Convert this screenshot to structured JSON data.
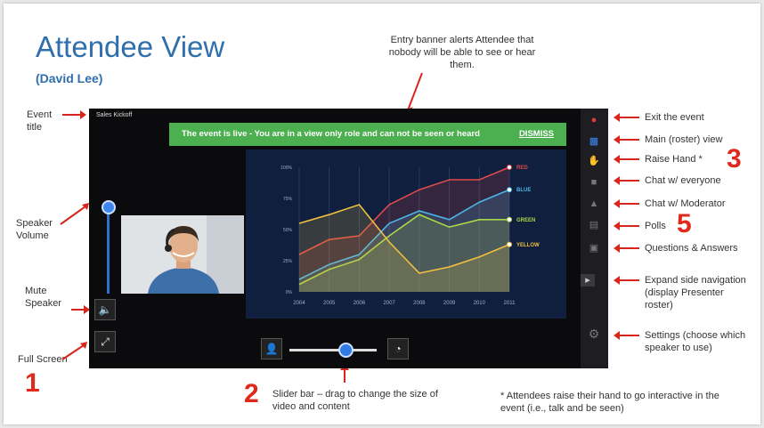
{
  "header": {
    "title": "Attendee View",
    "subtitle": "(David Lee)"
  },
  "annotations": {
    "entry_banner": "Entry banner alerts Attendee that nobody will be able to see or hear them.",
    "event_title": "Event title",
    "speaker_volume": "Speaker Volume",
    "mute_speaker": "Mute Speaker",
    "full_screen": "Full Screen",
    "num_1": "1",
    "num_2": "2",
    "num_3": "3",
    "num_5": "5",
    "slider_bar": "Slider bar – drag to change the size of video and content",
    "raise_hand_note": "* Attendees raise their hand to go interactive in the event (i.e., talk and be seen)",
    "exit_event": "Exit the event",
    "main_roster_view": "Main (roster) view",
    "raise_hand": "Raise Hand *",
    "chat_everyone": "Chat w/ everyone",
    "chat_moderator": "Chat w/ Moderator",
    "polls": "Polls",
    "qa": "Questions & Answers",
    "expand_side_nav": "Expand side navigation (display Presenter roster)",
    "settings": "Settings (choose which speaker to use)"
  },
  "app": {
    "event_title": "Sales Kickoff",
    "banner_message": "The event is live - You are in a view only role and can not be seen or heard",
    "dismiss_label": "DISMISS"
  },
  "sidebar_icons": [
    "exit-icon",
    "roster-icon",
    "raise-hand-icon",
    "chat-everyone-icon",
    "chat-moderator-icon",
    "polls-icon",
    "qa-icon",
    "expand-icon",
    "settings-icon"
  ],
  "colors": {
    "banner": "#4caf50",
    "chart_bg": "#0f1f3d",
    "red": "#e04a4a",
    "blue": "#4ab6e8",
    "green": "#a8d84a",
    "yellow": "#f0c040",
    "annotation_red": "#d9261c",
    "title_blue": "#2f6fad"
  },
  "chart_data": {
    "type": "line",
    "x": [
      "2004",
      "2005",
      "2006",
      "2007",
      "2008",
      "2009",
      "2010",
      "2011"
    ],
    "y_ticks": [
      "0%",
      "25%",
      "50%",
      "75%",
      "100%"
    ],
    "ylim": [
      0,
      100
    ],
    "series": [
      {
        "name": "RED",
        "values": [
          30,
          42,
          45,
          70,
          82,
          90,
          90,
          100
        ]
      },
      {
        "name": "BLUE",
        "values": [
          10,
          22,
          30,
          55,
          65,
          58,
          72,
          82
        ]
      },
      {
        "name": "GREEN",
        "values": [
          6,
          18,
          26,
          45,
          62,
          52,
          58,
          58
        ]
      },
      {
        "name": "YELLOW",
        "values": [
          55,
          62,
          70,
          40,
          15,
          20,
          28,
          38
        ]
      }
    ]
  }
}
